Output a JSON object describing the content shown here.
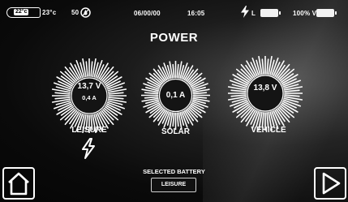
{
  "status_bar": {
    "temp_inside": "22°c",
    "temp_outside": "23°c",
    "water_level": "50",
    "date": "06/00/00",
    "time": "16:05",
    "battery_left_label": "L",
    "battery_right_label": "100% V"
  },
  "screen": {
    "title": "POWER"
  },
  "gauges": [
    {
      "name": "leisure",
      "value": "13,7 V",
      "sub_value": "0,4 A",
      "label": "LEISURE"
    },
    {
      "name": "solar",
      "value": "0,1 A",
      "label": "SOLAR"
    },
    {
      "name": "vehicle",
      "value": "13,8 V",
      "label": "VEHICLE"
    }
  ],
  "footer": {
    "selected_battery_label": "SELECTED BATTERY",
    "selected_battery_value": "LEISURE"
  },
  "icons": {
    "temperature": "thermometer-badge-icon",
    "water": "water-drop-icon",
    "charging": "lightning-bolt-icon",
    "home": "home-icon",
    "next": "play-arrow-icon"
  },
  "colors": {
    "background": "#050505",
    "foreground": "#ffffff"
  }
}
